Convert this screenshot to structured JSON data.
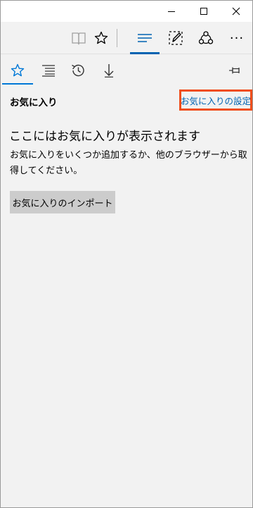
{
  "titlebar": {
    "minimize_icon": "minimize-icon",
    "maximize_icon": "maximize-icon",
    "close_icon": "close-icon"
  },
  "toolbar": {
    "icons": [
      "reading-view-icon",
      "favorite-star-icon",
      "hub-icon",
      "web-note-icon",
      "share-icon",
      "more-icon"
    ],
    "more_label": "···",
    "active": "hub"
  },
  "hub_tabs": {
    "tabs": [
      "favorites",
      "reading-list",
      "history",
      "downloads"
    ],
    "active": "favorites"
  },
  "pane": {
    "title": "お気に入り",
    "settings_link": "お気に入りの設定"
  },
  "empty_state": {
    "heading": "ここにはお気に入りが表示されます",
    "description": "お気に入りをいくつか追加するか、他のブラウザーから取得してください。",
    "import_button": "お気に入りのインポート"
  },
  "colors": {
    "accent": "#0078d7",
    "link": "#0063b1",
    "highlight_border": "#f04d1a",
    "pane_bg": "#f2f2f2",
    "button_bg": "#cccccc"
  }
}
